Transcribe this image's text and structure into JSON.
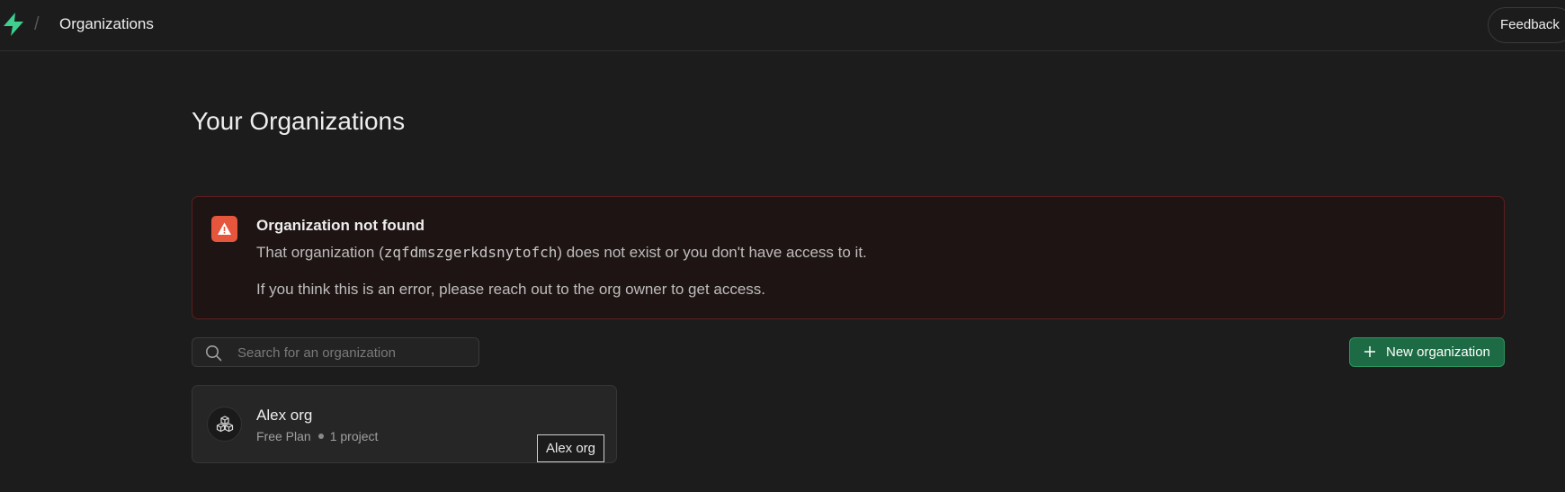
{
  "header": {
    "breadcrumb_separator": "/",
    "breadcrumb_current": "Organizations",
    "feedback_label": "Feedback",
    "logo_icon": "supabase-logo-icon",
    "brand_color": "#3ecf8e"
  },
  "main": {
    "title": "Your Organizations"
  },
  "alert": {
    "icon": "warning-triangle-icon",
    "title": "Organization not found",
    "line1_prefix": "That organization (",
    "org_slug": "zqfdmszgerkdsnytofch",
    "line1_suffix": ") does not exist or you don't have access to it.",
    "line2": "If you think this is an error, please reach out to the org owner to get access.",
    "accent_color": "#e5563d"
  },
  "search": {
    "placeholder": "Search for an organization",
    "value": "",
    "icon": "search-icon"
  },
  "new_org_button": {
    "label": "New organization",
    "icon": "plus-icon",
    "color": "#1d6b44"
  },
  "organizations": [
    {
      "name": "Alex org",
      "plan": "Free Plan",
      "projects": "1 project",
      "icon": "cubes-icon"
    }
  ],
  "tooltip": {
    "text": "Alex org"
  }
}
